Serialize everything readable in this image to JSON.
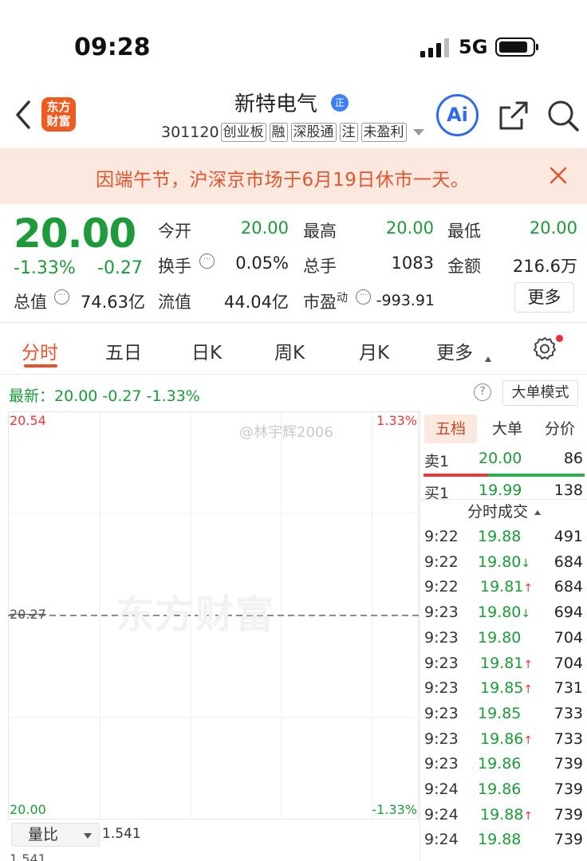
{
  "status": {
    "time": "09:28",
    "network": "5G"
  },
  "nav": {
    "logo_line1": "东方",
    "logo_line2": "财富",
    "stock_name": "新特电气",
    "verified_badge": "正",
    "stock_code": "301120",
    "tags": [
      "创业板",
      "融",
      "深股通",
      "注",
      "未盈利"
    ],
    "ai_label": "Ai"
  },
  "notice": {
    "text": "因端午节，沪深京市场于6月19日休市一天。"
  },
  "quote": {
    "price": "20.00",
    "pct": "-1.33%",
    "change": "-0.27",
    "open_label": "今开",
    "open": "20.00",
    "high_label": "最高",
    "high": "20.00",
    "low_label": "最低",
    "low": "20.00",
    "turnover_label": "换手",
    "turnover": "0.05%",
    "volume_label": "总手",
    "volume": "1083",
    "amount_label": "金额",
    "amount": "216.6万",
    "mktcap_label": "总值",
    "mktcap": "74.63亿",
    "float_label": "流值",
    "float": "44.04亿",
    "pe_label": "市盈",
    "pe_sup": "动",
    "pe": "-993.91",
    "more_label": "更多"
  },
  "tabs": [
    "分时",
    "五日",
    "日K",
    "周K",
    "月K",
    "更多"
  ],
  "latest": {
    "text": "最新：20.00  -0.27  -1.33%",
    "bigorder_label": "大单模式"
  },
  "chart_data": {
    "type": "line",
    "title": "",
    "ylim": [
      20.0,
      20.54
    ],
    "y_top_label": "20.54",
    "y_bottom_label": "20.00",
    "y_mid_label": "20.27",
    "pct_top_label": "1.33%",
    "pct_bottom_label": "-1.33%",
    "prev_close": 20.27,
    "grid": true
  },
  "watermark": "东方财富",
  "weibo_mark": "@林宇辉2006",
  "volume_ratio": {
    "label": "量比",
    "value": "1.541",
    "bottom_value": "1.541"
  },
  "side": {
    "tabs": [
      "五档",
      "大单",
      "分价"
    ],
    "sell1": {
      "label": "卖1",
      "price": "20.00",
      "vol": "86"
    },
    "buy1": {
      "label": "买1",
      "price": "19.99",
      "vol": "138"
    },
    "ticks_title": "分时成交",
    "ticks": [
      {
        "time": "9:22",
        "price": "19.88",
        "dir": "",
        "vol": "491"
      },
      {
        "time": "9:22",
        "price": "19.80",
        "dir": "down",
        "vol": "684"
      },
      {
        "time": "9:22",
        "price": "19.81",
        "dir": "up",
        "vol": "684"
      },
      {
        "time": "9:23",
        "price": "19.80",
        "dir": "down",
        "vol": "694"
      },
      {
        "time": "9:23",
        "price": "19.80",
        "dir": "",
        "vol": "704"
      },
      {
        "time": "9:23",
        "price": "19.81",
        "dir": "up",
        "vol": "704"
      },
      {
        "time": "9:23",
        "price": "19.85",
        "dir": "up",
        "vol": "731"
      },
      {
        "time": "9:23",
        "price": "19.85",
        "dir": "",
        "vol": "733"
      },
      {
        "time": "9:23",
        "price": "19.86",
        "dir": "up",
        "vol": "733"
      },
      {
        "time": "9:23",
        "price": "19.86",
        "dir": "",
        "vol": "739"
      },
      {
        "time": "9:24",
        "price": "19.86",
        "dir": "",
        "vol": "739"
      },
      {
        "time": "9:24",
        "price": "19.88",
        "dir": "up",
        "vol": "739"
      },
      {
        "time": "9:24",
        "price": "19.88",
        "dir": "",
        "vol": "739"
      }
    ]
  }
}
